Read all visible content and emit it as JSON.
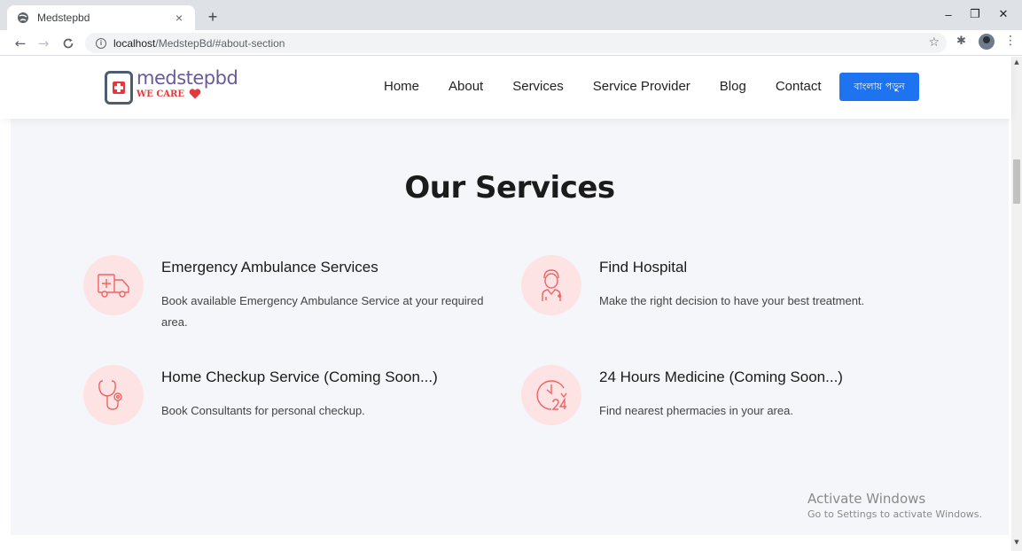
{
  "browser": {
    "tab_title": "Medstepbd",
    "tab_close": "×",
    "new_tab": "+",
    "url_host": "localhost",
    "url_path": "/MedstepBd/#about-section",
    "info": "i",
    "window_controls": [
      "–",
      "❐",
      "✕"
    ]
  },
  "site": {
    "logo_name": "medstepbd",
    "logo_tagline": "WE CARE",
    "nav": [
      "Home",
      "About",
      "Services",
      "Service Provider",
      "Blog",
      "Contact"
    ],
    "cta_label": "বাংলায় পড়ুন",
    "cta_color": "#1e73f0"
  },
  "section": {
    "title": "Our Services",
    "icon_bg": "#fde3e3",
    "icon_color": "#f06363",
    "services": [
      {
        "title": "Emergency Ambulance Services",
        "desc": "Book available Emergency Ambulance Service at your required area.",
        "icon": "ambulance-icon"
      },
      {
        "title": "Find Hospital",
        "desc": "Make the right decision to have your best treatment.",
        "icon": "doctor-icon"
      },
      {
        "title": "Home Checkup Service (Coming Soon...)",
        "desc": "Book Consultants for personal checkup.",
        "icon": "stethoscope-icon"
      },
      {
        "title": "24 Hours Medicine (Coming Soon...)",
        "desc": "Find nearest phermacies in your area.",
        "icon": "24-hours-icon"
      }
    ]
  },
  "watermark": {
    "line1": "Activate Windows",
    "line2": "Go to Settings to activate Windows."
  }
}
